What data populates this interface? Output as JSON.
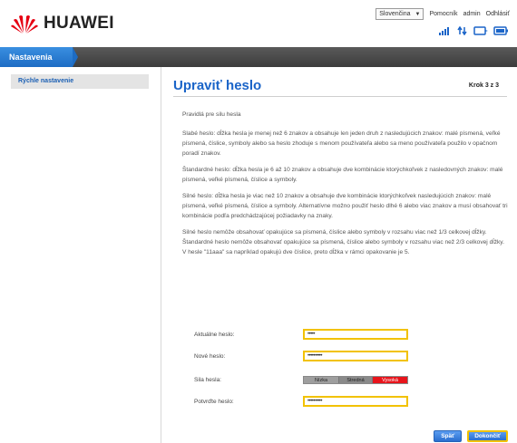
{
  "header": {
    "brand": "HUAWEI",
    "language": "Slovenčina",
    "links": [
      "Pomocník",
      "admin",
      "Odhlásiť"
    ]
  },
  "nav": {
    "active_tab": "Nastavenia"
  },
  "sidebar": {
    "items": [
      {
        "label": "Rýchle nastavenie"
      }
    ]
  },
  "main": {
    "title": "Upraviť heslo",
    "step": "Krok 3 z 3",
    "rules": [
      "Pravidlá pre silu hesla",
      "Slabé heslo: dĺžka hesla je menej než 6 znakov a obsahuje len jeden druh z nasledujúcich znakov: malé písmená, veľké písmená, číslice, symboly alebo sa heslo zhoduje s menom používateľa alebo sa meno používateľa použilo v opačnom poradí znakov.",
      "Štandardné heslo: dĺžka hesla je 6 až 10 znakov a obsahuje dve kombinácie ktorýchkoľvek z nasledovných znakov: malé písmená, veľké písmená, číslice a symboly.",
      "Silné heslo: dĺžka hesla je viac než 10 znakov a obsahuje dve kombinácie ktorýchkoľvek nasledujúcich znakov: malé písmená, veľké písmená, číslice a symboly. Alternatívne možno použiť heslo dlhé 6 alebo viac znakov a musí obsahovať tri kombinácie podľa predchádzajúcej požiadavky na znaky.",
      "Silné heslo nemôže obsahovať opakujúce sa písmená, číslice alebo symboly v rozsahu viac než 1/3 celkovej dĺžky. Štandardné heslo nemôže obsahovať opakujúce sa písmená, číslice alebo symboly v rozsahu viac než 2/3 celkovej dĺžky. V hesle \"11aaa\" sa napríklad opakujú dve číslice, preto dĺžka v rámci opakovanie je 5."
    ],
    "form": {
      "current_label": "Aktuálne heslo:",
      "current_value": "•••••",
      "new_label": "Nové heslo:",
      "new_value": "••••••••••",
      "strength_label": "Sila hesla:",
      "strength_levels": [
        "Nízka",
        "Stredná",
        "Vysoká"
      ],
      "strength_active": "Vysoká",
      "confirm_label": "Potvrďte heslo:",
      "confirm_value": "••••••••••"
    },
    "buttons": {
      "cancel": "Späť",
      "finish": "Dokončiť"
    }
  },
  "colors": {
    "accent_blue": "#1a64c8",
    "highlight_yellow": "#f2c200",
    "brand_red": "#e60012",
    "strength_strong": "#e8141b"
  }
}
